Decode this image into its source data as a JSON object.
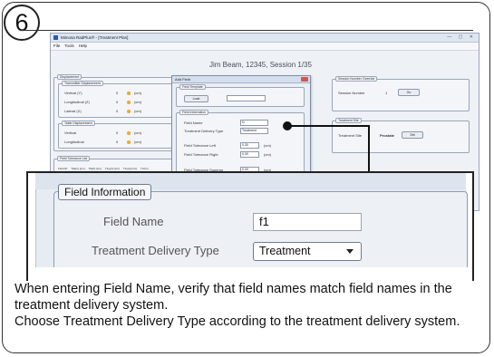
{
  "step_number": "6",
  "app": {
    "window_title": "Mimosa RadPlus® - [Treatment Plan]",
    "menu": [
      "File",
      "Tools",
      "Help"
    ],
    "session_title": "Jim Beam, 12345, Session 1/35"
  },
  "left_panel": {
    "displacement_label": "Displacement",
    "transmitter_label": "Transmitter Displacement",
    "rows": [
      {
        "label": "Vertical (Y)",
        "value": "0",
        "unit": "(cm)"
      },
      {
        "label": "Longitudinal (Z)",
        "value": "0",
        "unit": "(cm)"
      },
      {
        "label": "Lateral (X)",
        "value": "0",
        "unit": "(cm)"
      }
    ],
    "table_label": "Table Displacement",
    "table_rows": [
      {
        "label": "Vertical",
        "value": "0",
        "unit": "(cm)"
      },
      {
        "label": "Longitudinal",
        "value": "0",
        "unit": "(cm)"
      }
    ],
    "tolerance_label": "Field Tolerance List",
    "tolerance_columns": [
      "Field ID",
      "Tlat(n) [cm]",
      "Tlat(t) [cm]",
      "Tlng(n) [cm]",
      "Tlng(t) [cm]",
      "Tvrt(n)"
    ]
  },
  "dialog": {
    "title": "Add Field",
    "template_label": "Field Template",
    "load_label": "Load",
    "info_label": "Field Information",
    "rows": [
      {
        "label": "Field Name",
        "value": "f1",
        "unit": ""
      },
      {
        "label": "Treatment Delivery Type",
        "value": "Treatment",
        "unit": ""
      },
      {
        "label": "Field Tolerance Left",
        "value": "0.30",
        "unit": "(cm)"
      },
      {
        "label": "Field Tolerance Right",
        "value": "0.30",
        "unit": "(cm)"
      },
      {
        "label": "Field Tolerance Superior",
        "value": "0.30",
        "unit": "(cm)"
      }
    ]
  },
  "right_panel": {
    "override_label": "Session Number Override",
    "session_number_label": "Session Number",
    "session_number_value": "1",
    "go_label": "Go",
    "treatment_label": "Treatment Site",
    "treatment_site_label": "Treatment Site",
    "treatment_site_value": "Prostate",
    "set_label": "Set"
  },
  "zoom": {
    "section_label": "Field Information",
    "field_name_label": "Field Name",
    "field_name_value": "f1",
    "delivery_type_label": "Treatment Delivery Type",
    "delivery_type_value": "Treatment"
  },
  "instructions": [
    "When entering Field Name, verify that field names match field names in the treatment delivery system.",
    "Choose Treatment Delivery Type according to the treatment delivery system."
  ]
}
